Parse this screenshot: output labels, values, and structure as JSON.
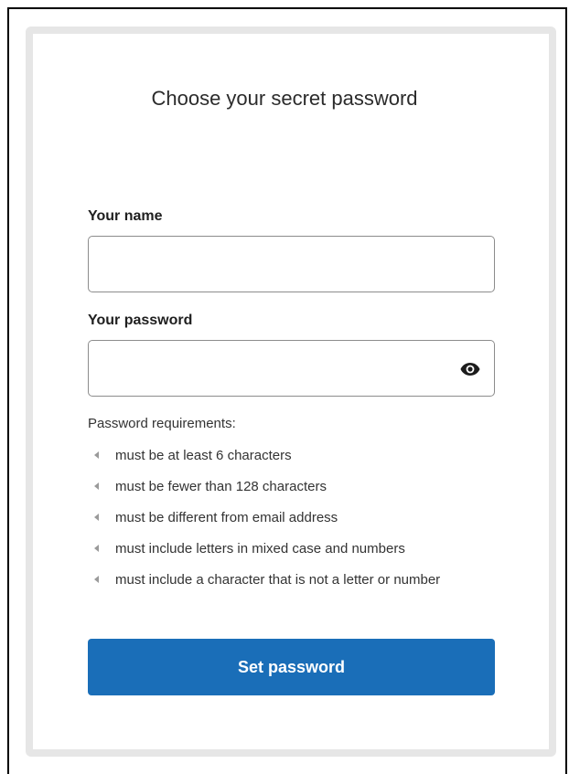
{
  "form": {
    "title": "Choose your secret password",
    "name_label": "Your name",
    "name_value": "",
    "password_label": "Your password",
    "password_value": "",
    "toggle_icon": "eye-icon",
    "requirements_title": "Password requirements:",
    "requirements": [
      "must be at least 6 characters",
      "must be fewer than 128 characters",
      "must be different from email address",
      "must include letters in mixed case and numbers",
      "must include a character that is not a letter or number"
    ],
    "submit_label": "Set password"
  },
  "colors": {
    "button": "#1a6eb8",
    "card_border": "#e6e6e6",
    "input_border": "#8c8c8c"
  }
}
